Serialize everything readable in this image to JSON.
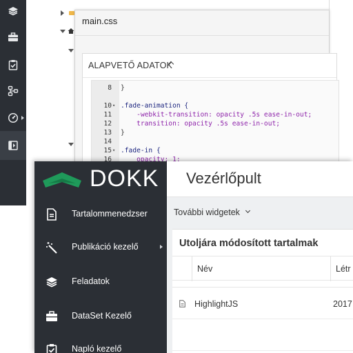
{
  "back_window": {
    "modal_title": "main.css",
    "panel_heading": "ALAPVETŐ ADATOK",
    "code_lines": [
      {
        "num": "8",
        "fold": "",
        "text": "}"
      },
      {
        "num": "10",
        "fold": "▾",
        "text": ".fade-animation {"
      },
      {
        "num": "11",
        "fold": "",
        "text": "    -webkit-transition: opacity .5s ease-in-out;"
      },
      {
        "num": "12",
        "fold": "",
        "text": "    transition: opacity .5s ease-in-out;"
      },
      {
        "num": "13",
        "fold": "",
        "text": "}"
      },
      {
        "num": "14",
        "fold": "",
        "text": ""
      },
      {
        "num": "15",
        "fold": "▾",
        "text": ".fade-in {"
      },
      {
        "num": "16",
        "fold": "",
        "text": "    opacity: 1;"
      }
    ]
  },
  "front_window": {
    "logo_text": "DOKK",
    "page_title": "Vezérlőpult",
    "widgets_button": "További widgetek",
    "sidebar": [
      {
        "label": "Tartalommenedzser",
        "icon": "document-icon"
      },
      {
        "label": "Publikáció kezelő",
        "icon": "magic-wand-icon",
        "has_submenu": true
      },
      {
        "label": "Feladatok",
        "icon": "layers-icon"
      },
      {
        "label": "DataSet Kezelő",
        "icon": "briefcase-icon"
      },
      {
        "label": "Napló kezelő",
        "icon": "clipboard-icon"
      }
    ],
    "card": {
      "title": "Utoljára módosított tartalmak",
      "columns": {
        "name": "Név",
        "created": "Létr"
      },
      "rows": [
        {
          "name": "HighlightJS",
          "date": "2017"
        },
        {
          "name": "",
          "date": ""
        }
      ]
    }
  },
  "colors": {
    "sidebar_bg": "#2b2f35",
    "logo_green": "#1f9a5a",
    "main_bg": "#eef0f2"
  }
}
